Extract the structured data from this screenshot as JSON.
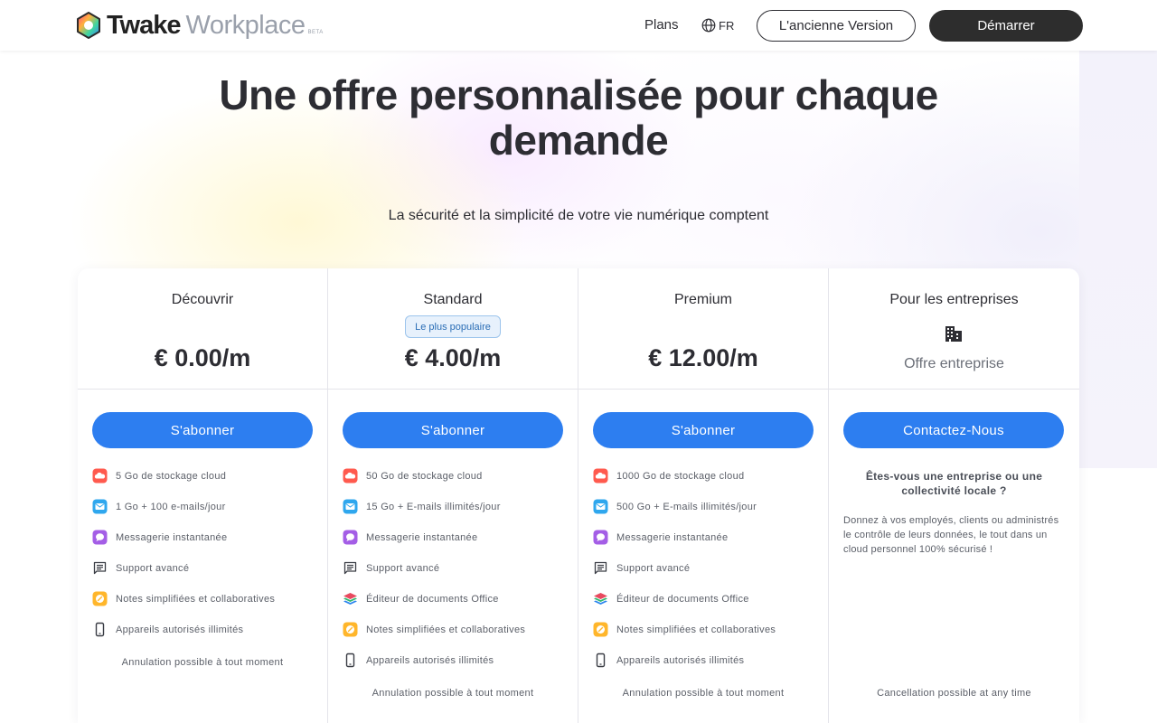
{
  "header": {
    "logo": {
      "name": "Twake",
      "product": "Workplace",
      "badge": "BETA"
    },
    "nav": {
      "plans": "Plans",
      "lang": "FR"
    },
    "old_version_label": "L'ancienne Version",
    "start_label": "Démarrer"
  },
  "hero": {
    "title": "Une offre personnalisée pour chaque demande",
    "subtitle": "La sécurité et la simplicité de votre vie numérique comptent"
  },
  "plans": [
    {
      "name": "Découvrir",
      "price": "€ 0.00/m",
      "button": "S'abonner",
      "features": [
        {
          "icon": "cloud-icon",
          "text": "5 Go de stockage cloud"
        },
        {
          "icon": "mail-icon",
          "text": "1 Go + 100 e-mails/jour"
        },
        {
          "icon": "chat-icon",
          "text": "Messagerie instantanée"
        },
        {
          "icon": "support-icon",
          "text": "Support avancé"
        },
        {
          "icon": "notes-icon",
          "text": "Notes simplifiées et collaboratives"
        },
        {
          "icon": "phone-icon",
          "text": "Appareils autorisés illimités"
        }
      ],
      "cancel": "Annulation possible à tout moment"
    },
    {
      "name": "Standard",
      "badge": "Le plus populaire",
      "price": "€ 4.00/m",
      "button": "S'abonner",
      "features": [
        {
          "icon": "cloud-icon",
          "text": "50 Go de stockage cloud"
        },
        {
          "icon": "mail-icon",
          "text": "15 Go + E-mails illimités/jour"
        },
        {
          "icon": "chat-icon",
          "text": "Messagerie instantanée"
        },
        {
          "icon": "support-icon",
          "text": "Support avancé"
        },
        {
          "icon": "office-icon",
          "text": "Éditeur de documents Office"
        },
        {
          "icon": "notes-icon",
          "text": "Notes simplifiées et collaboratives"
        },
        {
          "icon": "phone-icon",
          "text": "Appareils autorisés illimités"
        }
      ],
      "cancel": "Annulation possible à tout moment"
    },
    {
      "name": "Premium",
      "price": "€ 12.00/m",
      "button": "S'abonner",
      "features": [
        {
          "icon": "cloud-icon",
          "text": "1000 Go de stockage cloud"
        },
        {
          "icon": "mail-icon",
          "text": "500 Go + E-mails illimités/jour"
        },
        {
          "icon": "chat-icon",
          "text": "Messagerie instantanée"
        },
        {
          "icon": "support-icon",
          "text": "Support avancé"
        },
        {
          "icon": "office-icon",
          "text": "Éditeur de documents Office"
        },
        {
          "icon": "notes-icon",
          "text": "Notes simplifiées et collaboratives"
        },
        {
          "icon": "phone-icon",
          "text": "Appareils autorisés illimités"
        }
      ],
      "cancel": "Annulation possible à tout moment"
    },
    {
      "name": "Pour les entreprises",
      "offer": "Offre entreprise",
      "button": "Contactez-Nous",
      "question": "Êtes-vous une entreprise ou une collectivité locale ?",
      "description": "Donnez à vos employés, clients ou administrés le contrôle de leurs données, le tout dans un cloud personnel 100% sécurisé !",
      "cancel": "Cancellation possible at any time"
    }
  ],
  "colors": {
    "primary_button": "#2d7ef0",
    "dark_button": "#2d2d2d",
    "badge_bg": "#e7f1fc",
    "badge_text": "#2a6db5"
  }
}
